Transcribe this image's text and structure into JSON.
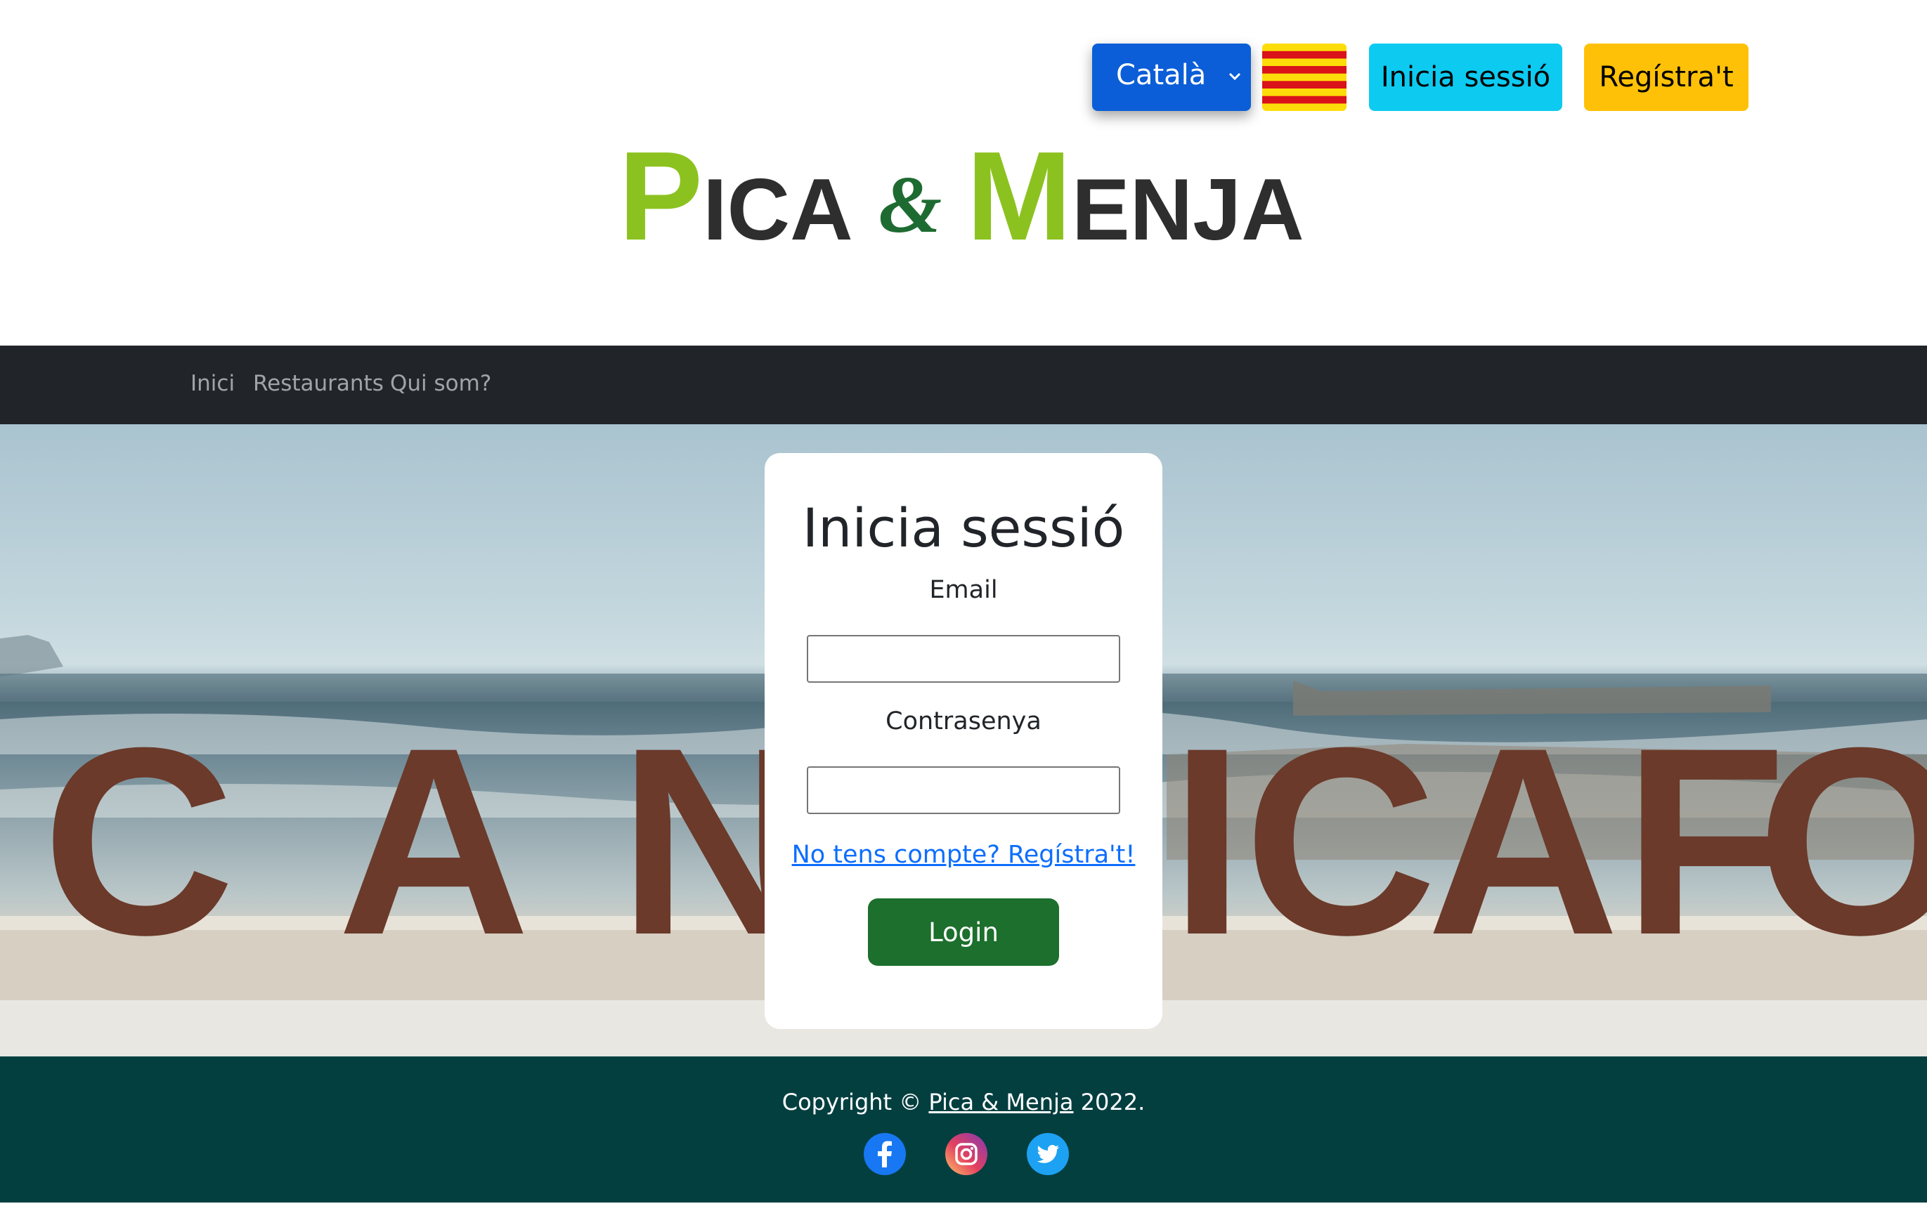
{
  "header": {
    "language_selected": "Català",
    "login_button": "Inicia sessió",
    "register_button": "Regístra't",
    "logo": {
      "p": "P",
      "ica": "ICA",
      "amp": "&",
      "m": "M",
      "enja": "ENJA"
    }
  },
  "nav": {
    "items": [
      {
        "label": "Inici"
      },
      {
        "label": "Restaurants"
      },
      {
        "label": "Qui som?"
      }
    ]
  },
  "hero": {
    "sign_letters": [
      "C",
      "A",
      "N",
      "I",
      "C",
      "A",
      "F",
      "O"
    ]
  },
  "login_card": {
    "title": "Inicia sessió",
    "email_label": "Email",
    "email_value": "",
    "password_label": "Contrasenya",
    "password_value": "",
    "register_link": "No tens compte? Regístra't!",
    "submit_button": "Login"
  },
  "footer": {
    "copyright_prefix": "Copyright © ",
    "brand": "Pica & Menja",
    "year_suffix": " 2022.",
    "social": [
      "facebook-icon",
      "instagram-icon",
      "twitter-icon"
    ]
  },
  "colors": {
    "language_select": "#0b5ed7",
    "login_top": "#0dcaf0",
    "register_top": "#ffc107",
    "nav_bg": "#212529",
    "footer_bg": "#043f40",
    "login_button": "#1c6f2c",
    "logo_green": "#8cc21f"
  }
}
